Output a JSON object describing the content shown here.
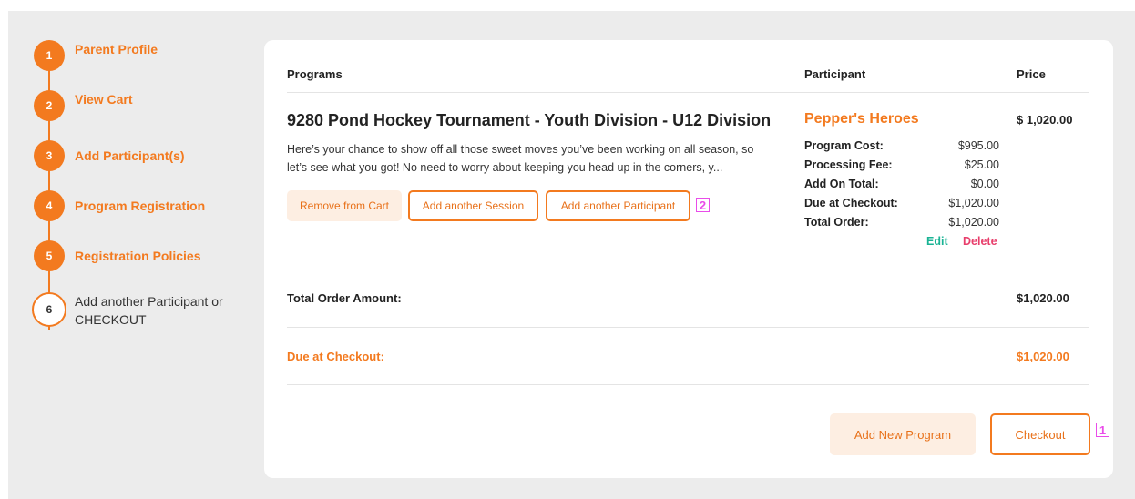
{
  "stepper": {
    "steps": [
      {
        "number": "1",
        "label": "Parent Profile"
      },
      {
        "number": "2",
        "label": "View Cart"
      },
      {
        "number": "3",
        "label": "Add Participant(s)"
      },
      {
        "number": "4",
        "label": "Program Registration"
      },
      {
        "number": "5",
        "label": "Registration Policies"
      },
      {
        "number": "6",
        "label_line1": "Add another Participant or",
        "label_line2": "CHECKOUT"
      }
    ]
  },
  "cart": {
    "headers": {
      "programs": "Programs",
      "participant": "Participant",
      "price": "Price"
    },
    "program": {
      "title": "9280 Pond Hockey Tournament - Youth Division - U12 Division",
      "description_line1": "Here’s your chance to show off all those sweet moves you’ve been working on all season, so",
      "description_line2": "let’s see what you got!  No need to worry about keeping you head up in the corners, y..."
    },
    "actions": {
      "remove": "Remove from Cart",
      "add_session": "Add another Session",
      "add_participant": "Add another Participant"
    },
    "participant": {
      "name": "Pepper's Heroes",
      "rows": [
        {
          "label": "Program Cost:",
          "value": "$995.00"
        },
        {
          "label": "Processing Fee:",
          "value": "$25.00"
        },
        {
          "label": "Add On Total:",
          "value": "$0.00"
        },
        {
          "label": "Due at Checkout:",
          "value": "$1,020.00"
        },
        {
          "label": "Total Order:",
          "value": "$1,020.00"
        }
      ],
      "edit": "Edit",
      "delete": "Delete"
    },
    "price": "$ 1,020.00",
    "total_order_label": "Total Order Amount:",
    "total_order_value": "$1,020.00",
    "due_label": "Due at Checkout:",
    "due_value": "$1,020.00",
    "add_new_program": "Add New Program",
    "checkout": "Checkout"
  },
  "annotations": {
    "badge_1": "1",
    "badge_2": "2"
  },
  "colors": {
    "accent": "#f37a1f",
    "accent_soft": "#fdeee2",
    "edit": "#1ab394",
    "delete": "#e83e6b",
    "annotation": "#e94ce9"
  }
}
